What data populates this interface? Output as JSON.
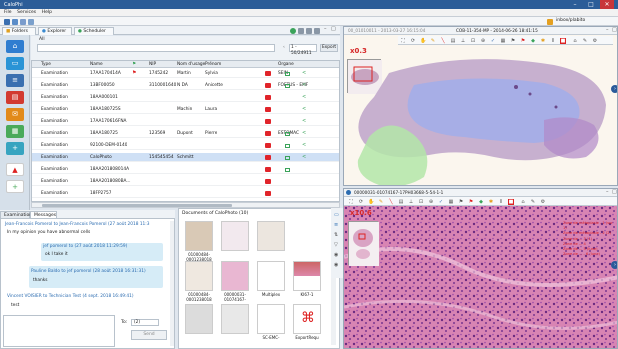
{
  "app": {
    "title": "CaloPhi",
    "user": "inbox/plabito"
  },
  "menu": [
    "File",
    "Services",
    "Help"
  ],
  "tabs": {
    "folders": "Folders",
    "explorer": "Explorer",
    "scheduler": "Scheduler"
  },
  "filter": {
    "field_label": "All",
    "range": "1 - 50/24911",
    "export": "Export"
  },
  "grid": {
    "columns": [
      "Type",
      "Name",
      "NIP",
      "Nom d'usage",
      "Prénom",
      "Organe"
    ],
    "rows": [
      {
        "type": "Examination",
        "name": "17AA170414A",
        "nip": "1745242",
        "nom": "Martin",
        "prenom": "Sylvia",
        "organe": "SEIN",
        "flag": true
      },
      {
        "type": "Examination",
        "name": "13BF00050",
        "nip": "3110001640",
        "nom": "N DA",
        "prenom": "Anicette",
        "organe": "FOETUS - EMF",
        "flag": false
      },
      {
        "type": "Examination",
        "name": "18AA000101",
        "nip": "",
        "nom": "",
        "prenom": "",
        "organe": "",
        "flag": false
      },
      {
        "type": "Examination",
        "name": "18AA180725S",
        "nip": "",
        "nom": "Machin",
        "prenom": "Laura",
        "organe": "",
        "flag": false
      },
      {
        "type": "Examination",
        "name": "17AA170616FNA",
        "nip": "",
        "nom": "",
        "prenom": "",
        "organe": "",
        "flag": false
      },
      {
        "type": "Examination",
        "name": "18AA180725",
        "nip": "123569",
        "nom": "Dupont",
        "prenom": "Pierre",
        "organe": "ESTOMAC",
        "flag": false
      },
      {
        "type": "Examination",
        "name": "92100-DEM-0140",
        "nip": "",
        "nom": "",
        "prenom": "",
        "organe": "",
        "flag": false
      },
      {
        "type": "Examination",
        "name": "CaloPhoto",
        "nip": "154545454",
        "nom": "Schmitt",
        "prenom": "",
        "organe": "",
        "flag": false
      },
      {
        "type": "Examination",
        "name": "18AA201808014A",
        "nip": "",
        "nom": "",
        "prenom": "",
        "organe": "",
        "flag": false
      },
      {
        "type": "Examination",
        "name": "18AA2018080BA...",
        "nip": "",
        "nom": "",
        "prenom": "",
        "organe": "",
        "flag": false
      },
      {
        "type": "Examination",
        "name": "18FP2757",
        "nip": "",
        "nom": "",
        "prenom": "",
        "organe": "",
        "flag": false
      }
    ]
  },
  "bottom_tabs": {
    "examination": "Examination",
    "messages": "Messages"
  },
  "messages": [
    {
      "header": "Jean-Francois Pomerol to Jean-Francois Pomerol (27 août 2018 11:3",
      "body": "In my opinion you have abnormal cells",
      "side": "left"
    },
    {
      "header": "jef pomerol to (27 août 2018 11:29:59)",
      "body": "ok I take it",
      "side": "right"
    },
    {
      "header": "Pauline Baldo to jef pomerol (28 août 2018 16:31:31)",
      "body": "thanks",
      "side": "right"
    },
    {
      "header": "Vincent VOISIER to Technician Test (4 sept. 2018 16:49:41)",
      "body": "test",
      "side": "left"
    }
  ],
  "compose": {
    "to_label": "To:",
    "to_value": "(2)",
    "send": "Send"
  },
  "documents": {
    "title": "Documents of CaloPhoto (10)",
    "items": [
      {
        "label": "01000484-0001238018"
      },
      {
        "label": ""
      },
      {
        "label": ""
      },
      {
        "label": "01000484-0001238018"
      },
      {
        "label": "00000031-01074167-"
      },
      {
        "label": "Multiplex"
      },
      {
        "label": "KI67-1"
      },
      {
        "label": ""
      },
      {
        "label": ""
      },
      {
        "label": "SC-EMC-"
      },
      {
        "label": "ExportRequ"
      }
    ]
  },
  "viewer_top": {
    "tab1": "00_01010011 - 2013-03-27 16:15:04",
    "tab2": "COB-11-354-MP - 2014-06-26 18:41:15",
    "zoom": "x0.3"
  },
  "viewer_bottom": {
    "title": "00000031-01074167-17PH03668-5-54-1-1",
    "zoom": "x10.6",
    "annotations": [
      "Zone de métaplasie - 1 (sur 1)",
      "Zone de métaplasie - 2 (2)",
      "Zone de ... 3 (1) ...",
      "Zone de ... 4",
      "Zone de ... 5 (lune)",
      "Zone de ... - 6 (lune)"
    ]
  }
}
